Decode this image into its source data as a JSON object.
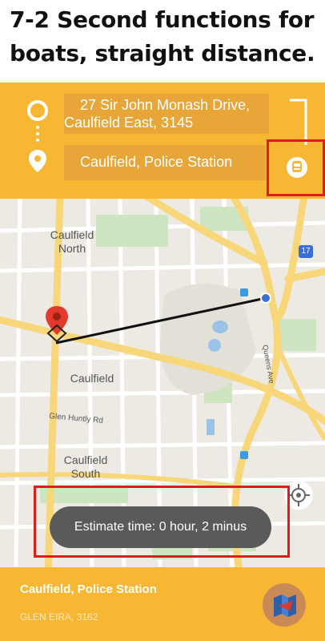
{
  "caption": {
    "line1": "7-2 Second functions for",
    "line2": "boats, straight distance."
  },
  "route": {
    "origin": "27 Sir John Monash Drive, Caulfield East, 3145",
    "origin_line1": "27 Sir John Monash Drive,",
    "origin_line2": "Caulfield East, 3145",
    "destination": "Caulfield, Police Station",
    "mode_icon": "boat-icon"
  },
  "map": {
    "labels": {
      "north_line1": "Caulfield",
      "north_line2": "North",
      "center": "Caulfield",
      "south_line1": "Caulfield",
      "south_line2": "South",
      "road": "Glen Huntly Rd",
      "avenue": "Queens Ave",
      "route_shield": "17"
    }
  },
  "toast": {
    "text": "Estimate time: 0 hour, 2 minus"
  },
  "bottom": {
    "place": "Caulfield, Police Station",
    "area": "GLEN EIRA, 3162"
  },
  "colors": {
    "accent": "#F7B733",
    "field": "#E8A638",
    "highlight": "#E01B1B",
    "toast": "#5a5a5a"
  }
}
